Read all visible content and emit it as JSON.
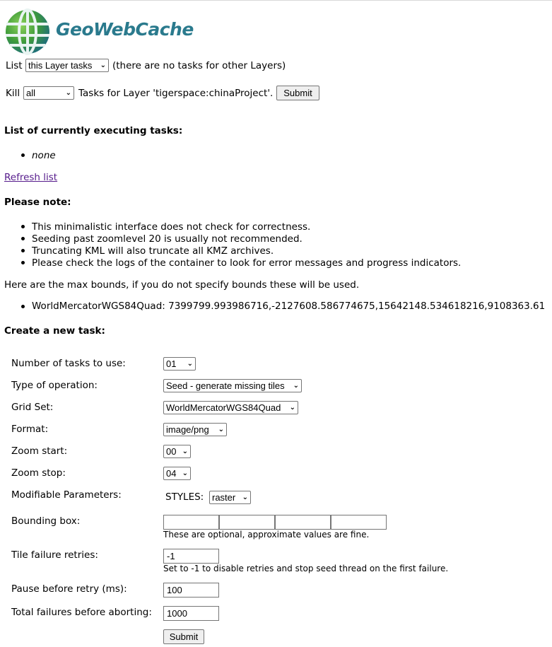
{
  "header": {
    "logo_text": "GeoWebCache"
  },
  "list_row": {
    "prefix": "List",
    "select_value": "this Layer tasks",
    "suffix": "(there are no tasks for other Layers)"
  },
  "kill_row": {
    "prefix": "Kill",
    "select_value": "all",
    "middle": "Tasks for Layer 'tigerspace:chinaProject'.",
    "submit_label": "Submit"
  },
  "executing": {
    "heading": "List of currently executing tasks:",
    "items": [
      "none"
    ]
  },
  "refresh_link": "Refresh list",
  "note": {
    "heading": "Please note:",
    "items": [
      "This minimalistic interface does not check for correctness.",
      "Seeding past zoomlevel 20 is usually not recommended.",
      "Truncating KML will also truncate all KMZ archives.",
      "Please check the logs of the container to look for error messages and progress indicators."
    ]
  },
  "bounds": {
    "intro": "Here are the max bounds, if you do not specify bounds these will be used.",
    "items": [
      "WorldMercatorWGS84Quad: 7399799.993986716,-2127608.586774675,15642148.534618216,9108363.61"
    ]
  },
  "create": {
    "heading": "Create a new task:",
    "fields": {
      "tasks": {
        "label": "Number of tasks to use:",
        "value": "01"
      },
      "operation": {
        "label": "Type of operation:",
        "value": "Seed - generate missing tiles"
      },
      "gridset": {
        "label": "Grid Set:",
        "value": "WorldMercatorWGS84Quad"
      },
      "format": {
        "label": "Format:",
        "value": "image/png"
      },
      "zoom_start": {
        "label": "Zoom start:",
        "value": "00"
      },
      "zoom_stop": {
        "label": "Zoom stop:",
        "value": "04"
      },
      "params": {
        "label": "Modifiable Parameters:",
        "param_name": "STYLES:",
        "value": "raster"
      },
      "bbox": {
        "label": "Bounding box:",
        "values": [
          "",
          "",
          "",
          ""
        ],
        "hint": "These are optional, approximate values are fine."
      },
      "retries": {
        "label": "Tile failure retries:",
        "value": "-1",
        "hint": "Set to -1 to disable retries and stop seed thread on the first failure."
      },
      "pause": {
        "label": "Pause before retry (ms):",
        "value": "100"
      },
      "total_failures": {
        "label": "Total failures before aborting:",
        "value": "1000"
      }
    },
    "submit_label": "Submit"
  },
  "colors": {
    "logo_teal": "#2a7a8d",
    "link_visited": "#551a8b",
    "button_bg": "#efefef"
  }
}
